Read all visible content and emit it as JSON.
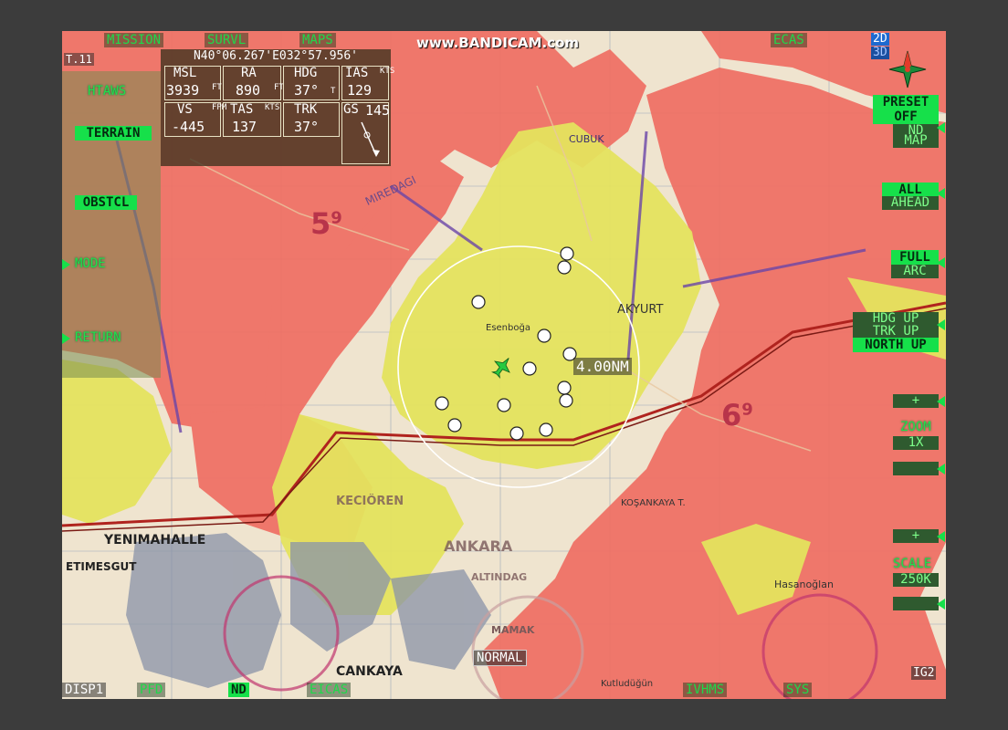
{
  "watermark": "www.BANDICAM.com",
  "top_tabs": [
    "MISSION",
    "SURVL",
    "MAPS",
    "ECAS"
  ],
  "view_toggle": {
    "two_d": "2D",
    "three_d": "3D"
  },
  "page_id": "T.11",
  "coords": "N40°06.267'E032°57.956'",
  "flight_data": {
    "msl_label": "MSL",
    "msl_value": "3939",
    "msl_unit": "FT",
    "ra_label": "RA",
    "ra_value": "890",
    "ra_unit": "FT",
    "hdg_label": "HDG",
    "hdg_value": "37°",
    "hdg_unit": "T",
    "ias_label": "IAS",
    "ias_value": "129",
    "ias_unit": "KTS",
    "vs_label": "VS",
    "vs_value": "-445",
    "vs_unit": "FPM",
    "tas_label": "TAS",
    "tas_value": "137",
    "tas_unit": "KTS",
    "trk_label": "TRK",
    "trk_value": "37°",
    "gs_label": "GS",
    "gs_value": "145"
  },
  "left_buttons": {
    "htaws": "HTAWS",
    "terrain": "TERRAIN",
    "obstcl": "OBSTCL",
    "mode": "MODE",
    "return": "RETURN"
  },
  "right_controls": {
    "preset_label": "PRESET",
    "preset_value": "OFF",
    "nd_map_1": "ND",
    "nd_map_2": "MAP",
    "all_label": "ALL",
    "ahead_label": "AHEAD",
    "full_label": "FULL",
    "arc_label": "ARC",
    "hdg_up": "HDG UP",
    "trk_up": "TRK UP",
    "north_up": "NORTH UP",
    "plus": "+",
    "zoom_label": "ZOOM",
    "zoom_value": "1X",
    "scale_label": "SCALE",
    "scale_value": "250K"
  },
  "range_ring_label": "4.00NM",
  "mode_status": "NORMAL",
  "bottom_tabs": [
    "DISP1",
    "PFD",
    "ND",
    "EICAS",
    "IVHMS",
    "SYS"
  ],
  "bottom_right_id": "IG2",
  "map_labels": {
    "miredagi": "MIREDAGI",
    "cubuk": "CUBUK",
    "akyurt": "AKYURT",
    "yenimahalle": "YENIMAHALLE",
    "etimesgut": "ETIMESGUT",
    "ankara": "ANKARA",
    "mamak": "MAMAK",
    "cankaya": "CANKAYA",
    "elevation_5": "5",
    "elevation_6": "6",
    "sup_9": "9",
    "keciören": "KECIÖREN",
    "altindag": "ALTINDAG",
    "hasanoglan": "Hasanoğlan",
    "kurtulus": "Kutludüğün",
    "kosankaya": "KOŞANKAYA T.",
    "esenboga": "Esenboğa"
  },
  "colors": {
    "terrain_red": "#ef6e63",
    "terrain_yellow": "#e4e35e",
    "map_base": "#efe4cf",
    "osd_green": "#16e04a",
    "route_red": "#b0231e"
  }
}
